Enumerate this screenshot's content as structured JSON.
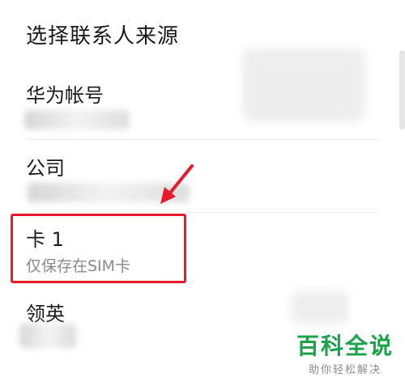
{
  "dialog": {
    "title": "选择联系人来源",
    "options": [
      {
        "title": "华为帐号"
      },
      {
        "title": "公司"
      },
      {
        "title": "卡 1",
        "subtitle": "仅保存在SIM卡"
      },
      {
        "title": "领英"
      }
    ]
  },
  "annotation": {
    "highlight_color": "#e8192a",
    "arrow_color": "#e8192a",
    "highlighted_option": "卡 1"
  },
  "watermark": {
    "brand": "百科全说",
    "slogan": "助你轻松解决",
    "brand_color": "#18a34a"
  }
}
